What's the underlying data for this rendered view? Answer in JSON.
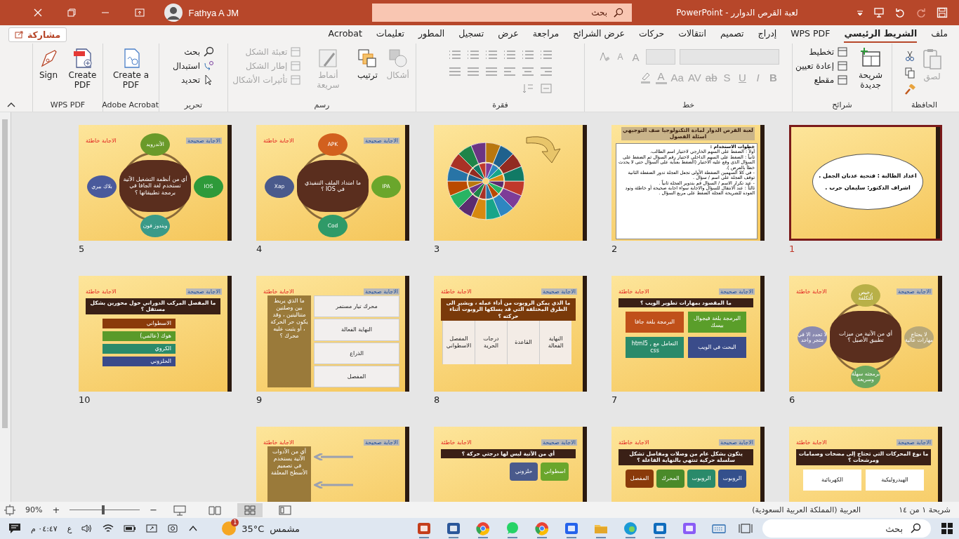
{
  "title_bar": {
    "document": "لعبة القرص الدوارر",
    "separator": "-",
    "app": "PowerPoint",
    "search_placeholder": "بحث",
    "user": "Fathya A JM"
  },
  "tabs": [
    {
      "label": "ملف",
      "selected": false
    },
    {
      "label": "الشريط الرئيسي",
      "selected": true
    },
    {
      "label": "WPS PDF",
      "selected": false
    },
    {
      "label": "إدراج",
      "selected": false
    },
    {
      "label": "تصميم",
      "selected": false
    },
    {
      "label": "انتقالات",
      "selected": false
    },
    {
      "label": "حركات",
      "selected": false
    },
    {
      "label": "عرض الشرائح",
      "selected": false
    },
    {
      "label": "مراجعة",
      "selected": false
    },
    {
      "label": "عرض",
      "selected": false
    },
    {
      "label": "تسجيل",
      "selected": false
    },
    {
      "label": "المطور",
      "selected": false
    },
    {
      "label": "تعليمات",
      "selected": false
    },
    {
      "label": "Acrobat",
      "selected": false
    }
  ],
  "share_button": "مشاركة",
  "ribbon": {
    "groups": [
      {
        "name": "الحافظة",
        "kind": "clipboard",
        "items": [
          {
            "label": "لصق",
            "kind": "large",
            "disabled": true
          }
        ]
      },
      {
        "name": "شرائح",
        "kind": "slides",
        "items": [
          {
            "label": "شريحة جديدة",
            "kind": "large",
            "disabled": false
          },
          {
            "label": "تخطيط",
            "kind": "small",
            "disabled": false
          },
          {
            "label": "إعادة تعيين",
            "kind": "small",
            "disabled": false
          },
          {
            "label": "مقطع",
            "kind": "small",
            "disabled": false
          }
        ]
      },
      {
        "name": "خط",
        "kind": "font",
        "top_items": [
          {
            "label": "A",
            "disabled": true
          },
          {
            "label": "A",
            "disabled": true
          }
        ],
        "items": [
          {
            "label": "B",
            "disabled": true
          },
          {
            "label": "I",
            "disabled": true
          },
          {
            "label": "U",
            "disabled": true
          },
          {
            "label": "S",
            "disabled": true
          },
          {
            "label": "ab",
            "disabled": true
          },
          {
            "label": "AV",
            "disabled": true
          },
          {
            "label": "Aa",
            "disabled": true
          },
          {
            "label": "A",
            "disabled": true
          }
        ]
      },
      {
        "name": "فقرة",
        "kind": "paragraph"
      },
      {
        "name": "رسم",
        "kind": "drawing",
        "items": [
          {
            "label": "أشكال",
            "kind": "large",
            "disabled": true
          },
          {
            "label": "ترتيب",
            "kind": "large",
            "disabled": false
          },
          {
            "label": "أنماط سريعة",
            "kind": "large",
            "disabled": true
          },
          {
            "label": "تعبئة الشكل",
            "kind": "small",
            "disabled": true
          },
          {
            "label": "إطار الشكل",
            "kind": "small",
            "disabled": true
          },
          {
            "label": "تأثيرات الأشكال",
            "kind": "small",
            "disabled": true
          }
        ]
      },
      {
        "name": "تحرير",
        "kind": "editing",
        "items": [
          {
            "label": "بحث",
            "kind": "small",
            "disabled": false
          },
          {
            "label": "استبدال",
            "kind": "small",
            "disabled": false
          },
          {
            "label": "تحديد",
            "kind": "small",
            "disabled": false
          }
        ]
      },
      {
        "name": "Adobe Acrobat",
        "kind": "acrobat",
        "items": [
          {
            "label": "Create a PDF",
            "kind": "large",
            "disabled": false
          }
        ]
      },
      {
        "name": "WPS PDF",
        "kind": "wps",
        "items": [
          {
            "label": "Create PDF",
            "kind": "large",
            "disabled": false
          },
          {
            "label": "Sign",
            "kind": "large",
            "disabled": false
          }
        ]
      }
    ]
  },
  "slides": [
    {
      "number": "1",
      "selected": true,
      "kind": "cloud",
      "lines": [
        "اعداد الطالبة : فتحية عدنان الجمل .",
        "اشراف الدكتور: سليمان حرب ."
      ]
    },
    {
      "number": "2",
      "selected": false,
      "kind": "card",
      "title": "لعبة القرص الدوار لمادة التكنولوجيا صف التوجيهي اسئلة الفصول",
      "lines": [
        "خطوات الاستخدام :",
        "أولاً : الضغط على السهم الخارجي لاختيار اسم الطالب.",
        "ثانياً : الضغط على السهم الداخلي لاختيار رقم السؤال ثم الضغط على السؤال الذي وقع عليه الاختيار (الضغط بعناية على السؤال حتى لا يحدث خطأ بالعرض ).",
        "- في كلا السهمين الضغطة الأولى تجعل العجلة تدور الضغطة الثانية توقف العجلة على اسم / سؤال .",
        "- عند تكرار الاسم / السؤال قم بتدوير العجلة ثانياً .",
        "ثالثاً : عند الانتقال للسؤال والاجابة سواء اجابة صحيحة أو خاطئة وتود العودة للشريحة العجلة الضغط على مربع السؤال ."
      ]
    },
    {
      "number": "3",
      "selected": false,
      "kind": "wheel"
    },
    {
      "number": "4",
      "selected": false,
      "kind": "cycle",
      "badges": [
        {
          "text": "الاجابة صحيحة",
          "kind": "correct"
        },
        {
          "text": "الاجابة خاطئة",
          "kind": "wrong"
        }
      ],
      "center": "ما امتداد الملف التنفيذي في IOS ؟",
      "boxes": [
        {
          "text": "APK",
          "color": "#d2601e"
        },
        {
          "text": "IPA",
          "color": "#6aa62c"
        },
        {
          "text": "Cod",
          "color": "#2f9a68"
        },
        {
          "text": "Xap",
          "color": "#4a5a8c"
        }
      ]
    },
    {
      "number": "5",
      "selected": false,
      "kind": "cycle",
      "badges": [
        {
          "text": "الاجابة صحيحة",
          "kind": "correct"
        },
        {
          "text": "الاجابة خاطئة",
          "kind": "wrong"
        }
      ],
      "center": "أي من أنظمة التشغيل الآتية تستخدم لغة الجافا في برمجة تطبيقاتها ؟",
      "boxes": [
        {
          "text": "الأندرويد",
          "color": "#6a9a2a"
        },
        {
          "text": "IOS",
          "color": "#2e9a3a"
        },
        {
          "text": "ويندوز فون",
          "color": "#3a9a88"
        },
        {
          "text": "بلاك بيري",
          "color": "#4a5a9c"
        }
      ]
    },
    {
      "number": "6",
      "selected": false,
      "kind": "cycle",
      "badges": [
        {
          "text": "الاجابة صحيحة",
          "kind": "correct"
        },
        {
          "text": "الاجابة خاطئة",
          "kind": "wrong"
        }
      ],
      "center": "أي من الآتية من ميزات تطبيق الأصيل ؟",
      "boxes": [
        {
          "text": "رخيص التكلفة",
          "color": "#b8b048"
        },
        {
          "text": "لا يحتاج مهارات عالية",
          "color": "#b8a878"
        },
        {
          "text": "برمجته سهلة وسريعة",
          "color": "#6aa860"
        },
        {
          "text": "لا تحدد الا في متجر واحد",
          "color": "#8a8ab0"
        }
      ]
    },
    {
      "number": "7",
      "selected": false,
      "kind": "grid",
      "badges": [
        {
          "text": "الاجابة صحيحة",
          "kind": "correct"
        },
        {
          "text": "الاجابة خاطئة",
          "kind": "wrong"
        }
      ],
      "title": "ما المقصود بمهارات تطوير الويب ؟",
      "boxes": [
        {
          "text": "البرمجة بلغة فيجوال بيسك",
          "color": "#5a9e2a"
        },
        {
          "text": "البرمجة بلغة جافا",
          "color": "#c0501a"
        },
        {
          "text": "البحث في الويب",
          "color": "#3a4c8a"
        },
        {
          "text": "التعامل مع html5 , css",
          "color": "#2a8a6a"
        }
      ]
    },
    {
      "number": "8",
      "selected": false,
      "kind": "table",
      "badges": [
        {
          "text": "الاجابة صحيحة",
          "kind": "correct"
        },
        {
          "text": "الاجابة خاطئة",
          "kind": "wrong"
        }
      ],
      "title": "ما الذي يمكن الروبوت من أداء عمله ، ويشير الى الطرق المختلفة التي قد يسلكها الروبوت أثناء حركته ؟",
      "boxes": [
        {
          "text": "النهاية الفعالة",
          "color": "#f3ece6"
        },
        {
          "text": "القاعدة",
          "color": "#f3ece6"
        },
        {
          "text": "درجات الحرية",
          "color": "#f3ece6"
        },
        {
          "text": "المفصل الاسطواني",
          "color": "#f3ece6"
        }
      ]
    },
    {
      "number": "9",
      "selected": false,
      "kind": "side",
      "badges": [
        {
          "text": "الاجابة صحيحة",
          "kind": "correct"
        },
        {
          "text": "الاجابة خاطئة",
          "kind": "wrong"
        }
      ],
      "title": "ما الذي يربط بين وصلتين متتاليتين ، وقد يكون حر الحركة ، أو يثبت عليه محرك ؟",
      "boxes": [
        {
          "text": "محرك تيار مستمر",
          "color": "#f2efee"
        },
        {
          "text": "النهاية الفعالة",
          "color": "#f2efee"
        },
        {
          "text": "الذراع",
          "color": "#f2efee"
        },
        {
          "text": "المفصل",
          "color": "#f2efee"
        }
      ]
    },
    {
      "number": "10",
      "selected": false,
      "kind": "list",
      "badges": [
        {
          "text": "الاجابة صحيحة",
          "kind": "correct"
        },
        {
          "text": "الاجابة خاطئة",
          "kind": "wrong"
        }
      ],
      "title": "ما المفصل المركب الدوراني حول محورين بشكل مستقل ؟",
      "boxes": [
        {
          "text": "الاسطواني",
          "color": "#8a3a0a"
        },
        {
          "text": "هوك (عالمي)",
          "color": "#5a9a2a"
        },
        {
          "text": "الكروي",
          "color": "#2a8a6a"
        },
        {
          "text": "الحلزوني",
          "color": "#3a4a8a"
        }
      ]
    },
    {
      "selected": false,
      "kind": "grid",
      "badges": [
        {
          "text": "الاجابة صحيحة",
          "kind": "correct"
        },
        {
          "text": "الاجابة خاطئة",
          "kind": "wrong"
        }
      ],
      "title": "ما نوع المحركات التي تحتاج إلى مضخات وصمامات ومرشحات ؟",
      "boxes": [
        {
          "text": "الهيدروليكية",
          "color": "#ffffff"
        },
        {
          "text": "الكهربائية",
          "color": "#ffffff"
        }
      ]
    },
    {
      "selected": false,
      "kind": "row",
      "badges": [
        {
          "text": "الاجابة صحيحة",
          "kind": "correct"
        },
        {
          "text": "الاجابة خاطئة",
          "kind": "wrong"
        }
      ],
      "title": "يتكون بشكل عام من وصلات ومفاصل تشكل سلسلة حركية تنتهي بالنهاية الفاعلة ؟",
      "boxes": [
        {
          "text": "الروبوت",
          "color": "#34508c"
        },
        {
          "text": "الروبوت",
          "color": "#2a8a6a"
        },
        {
          "text": "المحرك",
          "color": "#4a8a2a"
        },
        {
          "text": "المفصل",
          "color": "#8a3a0a"
        }
      ]
    },
    {
      "selected": false,
      "kind": "row",
      "badges": [
        {
          "text": "الاجابة صحيحة",
          "kind": "correct"
        },
        {
          "text": "الاجابة خاطئة",
          "kind": "wrong"
        }
      ],
      "title": "أي من الآتية ليس لها درجتي حركة ؟",
      "boxes": [
        {
          "text": "اسطواني",
          "color": "#6aa62c"
        },
        {
          "text": "حلزوني",
          "color": "#4a5a8c"
        }
      ]
    },
    {
      "selected": false,
      "kind": "side",
      "badges": [
        {
          "text": "الاجابة صحيحة",
          "kind": "correct"
        },
        {
          "text": "الاجابة خاطئة",
          "kind": "wrong"
        }
      ],
      "title": "أي من الأدوات الآتية يستخدم في تصميم الأسطح المعلقة"
    }
  ],
  "status_bar": {
    "slide_counter": "شريحة ١ من ١٤",
    "language": "العربية (المملكة العربية السعودية)",
    "zoom": "90%",
    "zoom_minus": "−",
    "zoom_plus": "+",
    "zoom_slider": {
      "level": 0.5
    },
    "views": [
      {
        "kind": "normal",
        "selected": false
      },
      {
        "kind": "sorter",
        "selected": true
      },
      {
        "kind": "reading",
        "selected": false
      },
      {
        "kind": "slideshow",
        "selected": false
      }
    ]
  },
  "taskbar": {
    "search_placeholder": "بحث",
    "apps": [
      {
        "kind": "keyboard",
        "running": false
      },
      {
        "kind": "copilot",
        "running": false
      },
      {
        "kind": "mail",
        "running": true
      },
      {
        "kind": "edge",
        "running": true
      },
      {
        "kind": "folder",
        "running": true
      },
      {
        "kind": "store",
        "running": true
      },
      {
        "kind": "chrome",
        "running": true
      },
      {
        "kind": "chat",
        "running": true
      },
      {
        "kind": "chrome",
        "running": true
      },
      {
        "kind": "word",
        "running": true
      },
      {
        "kind": "slides",
        "running": true
      }
    ],
    "weather": {
      "temperature": "35°C",
      "condition": "مشمس",
      "badge": "1"
    },
    "input_language": "ع",
    "time": "٠٤:٤٧ م"
  }
}
